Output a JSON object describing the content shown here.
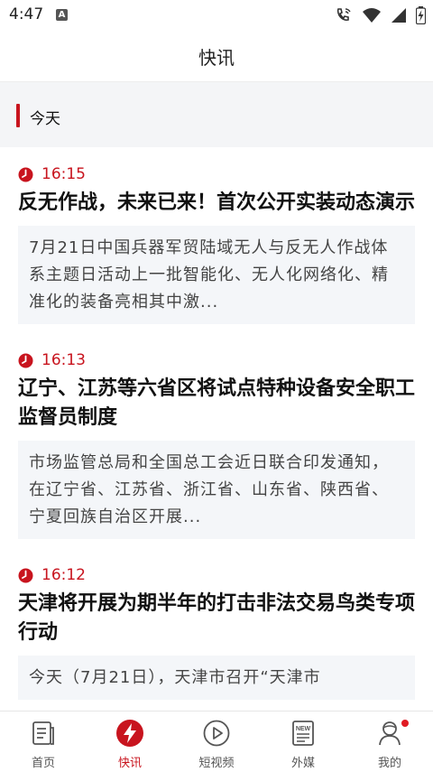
{
  "status_bar": {
    "time": "4:47",
    "notif_letter": "A"
  },
  "header": {
    "title": "快讯"
  },
  "day_section": {
    "label": "今天"
  },
  "news": [
    {
      "time": "16:15",
      "title": "反无作战，未来已来！首次公开实装动态演示",
      "summary": "7月21日中国兵器军贸陆域无人与反无人作战体系主题日活动上一批智能化、无人化网络化、精准化的装备亮相其中激..."
    },
    {
      "time": "16:13",
      "title": "辽宁、江苏等六省区将试点特种设备安全职工监督员制度",
      "summary": "市场监管总局和全国总工会近日联合印发通知，在辽宁省、江苏省、浙江省、山东省、陕西省、宁夏回族自治区开展..."
    },
    {
      "time": "16:12",
      "title": "天津将开展为期半年的打击非法交易鸟类专项行动",
      "summary": "今天（7月21日），天津市召开“天津市"
    }
  ],
  "tabs": [
    {
      "label": "首页",
      "icon": "home-doc-icon"
    },
    {
      "label": "快讯",
      "icon": "flash-icon"
    },
    {
      "label": "短视频",
      "icon": "play-icon"
    },
    {
      "label": "外媒",
      "icon": "newspaper-icon"
    },
    {
      "label": "我的",
      "icon": "profile-icon"
    }
  ],
  "colors": {
    "accent": "#c8141e",
    "summary_bg": "#f4f6f9",
    "section_bg": "#f4f5f7"
  }
}
